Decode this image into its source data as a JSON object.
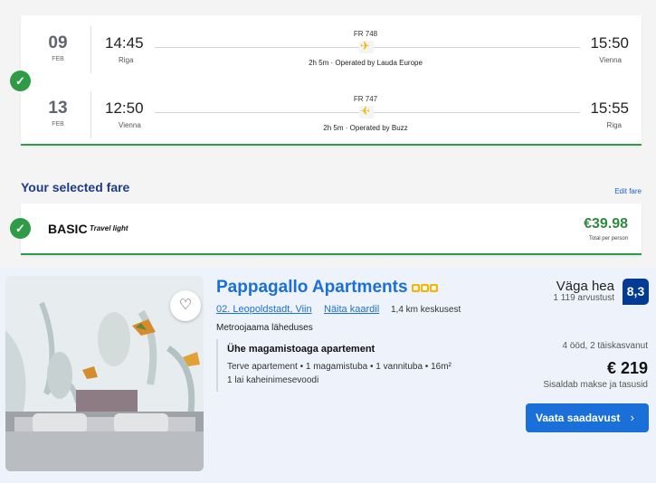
{
  "flights": [
    {
      "day": "09",
      "month": "FEB",
      "dep_time": "14:45",
      "dep_city": "Riga",
      "flight_no": "FR 748",
      "duration": "2h 5m · Operated by Lauda Europe",
      "arr_time": "15:50",
      "arr_city": "Vienna",
      "plane_icon": "plane-outbound-icon"
    },
    {
      "day": "13",
      "month": "FEB",
      "dep_time": "12:50",
      "dep_city": "Vienna",
      "flight_no": "FR 747",
      "duration": "2h 5m · Operated by Buzz",
      "arr_time": "15:55",
      "arr_city": "Riga",
      "plane_icon": "plane-return-icon"
    }
  ],
  "fare": {
    "section_title": "Your selected fare",
    "edit_label": "Edit fare",
    "name": "BASIC",
    "subtitle": "Travel light",
    "price": "€39.98",
    "per_person": "Total per person"
  },
  "hotel": {
    "name": "Pappagallo Apartments",
    "star_count": 3,
    "location": "02. Leopoldstadt, Viin",
    "map_link": "Näita kaardil",
    "distance": "1,4 km keskusest",
    "metro": "Metroojaama läheduses",
    "room_type": "Ühe magamistoaga apartement",
    "room_details": "Terve apartement • 1 magamistuba • 1 vannituba • 16m²",
    "bed": "1 lai kaheinimesevoodi",
    "rating_word": "Väga hea",
    "reviews": "1 119 arvustust",
    "score": "8,3",
    "nights_guests": "4 ööd, 2 täiskasvanut",
    "price": "€ 219",
    "taxes": "Sisaldab makse ja tasusid",
    "cta": "Vaata saadavust"
  },
  "colors": {
    "accent_green": "#2e9b46",
    "brand_blue": "#1a6fd8",
    "score_blue": "#013b94",
    "star_yellow": "#f6b40a"
  }
}
